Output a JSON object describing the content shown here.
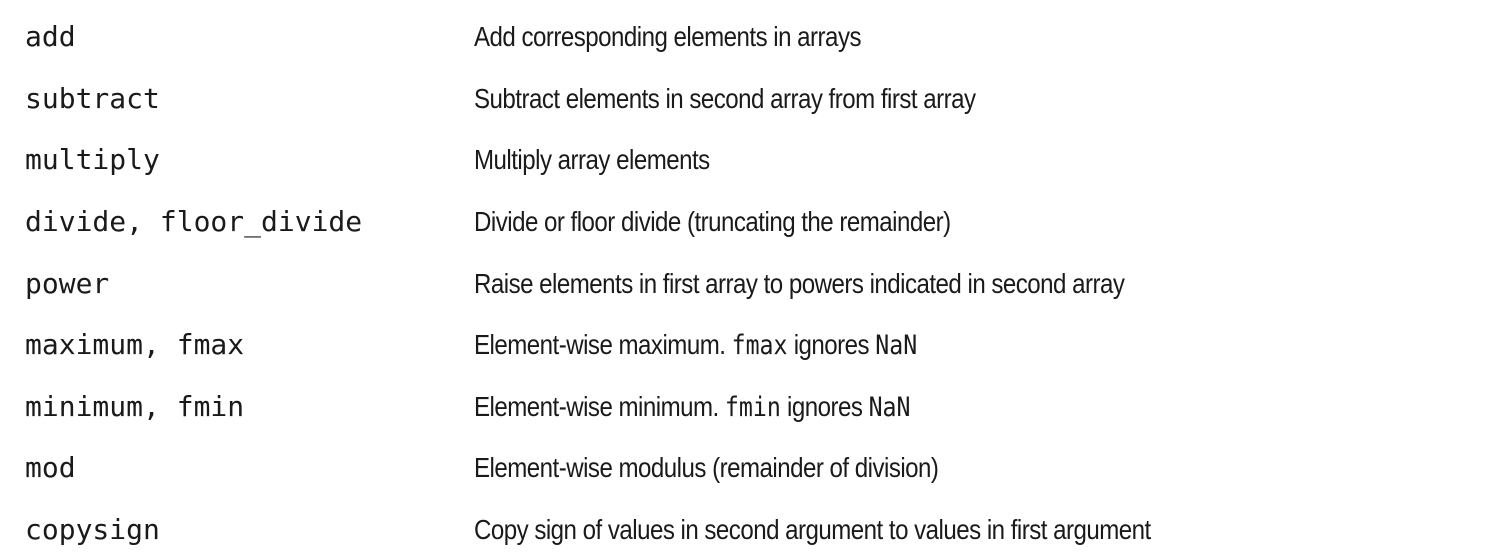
{
  "rows": [
    {
      "function": "add",
      "description": "Add corresponding elements in arrays"
    },
    {
      "function": "subtract",
      "description": "Subtract elements in second array from first array"
    },
    {
      "function": "multiply",
      "description": "Multiply array elements"
    },
    {
      "function": "divide, floor_divide",
      "description": "Divide or floor divide (truncating the remainder)"
    },
    {
      "function": "power",
      "description": "Raise elements in first array to powers indicated in second array"
    },
    {
      "function": "maximum, fmax",
      "description_prefix": "Element-wise maximum. ",
      "description_code1": "fmax",
      "description_mid": " ignores ",
      "description_code2": "NaN"
    },
    {
      "function": "minimum, fmin",
      "description_prefix": "Element-wise minimum. ",
      "description_code1": "fmin",
      "description_mid": " ignores ",
      "description_code2": "NaN"
    },
    {
      "function": "mod",
      "description": "Element-wise modulus (remainder of division)"
    },
    {
      "function": "copysign",
      "description": "Copy sign of values in second argument to values in first argument"
    }
  ]
}
